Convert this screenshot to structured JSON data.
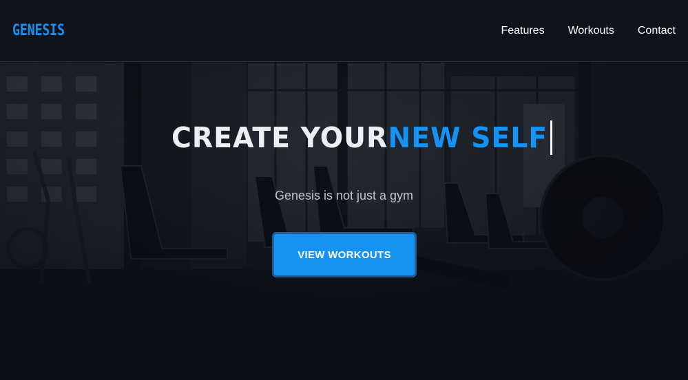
{
  "header": {
    "logo_text": "GENESIS",
    "nav": [
      {
        "label": "Features"
      },
      {
        "label": "Workouts"
      },
      {
        "label": "Contact"
      }
    ]
  },
  "hero": {
    "headline_white": "CREATE YOUR",
    "headline_blue": "NEW SELF",
    "subtitle": "Genesis is not just a gym",
    "cta_label": "VIEW WORKOUTS"
  },
  "colors": {
    "accent": "#1592f3",
    "header_bg": "#0f131c",
    "page_bg": "#0c1018"
  }
}
